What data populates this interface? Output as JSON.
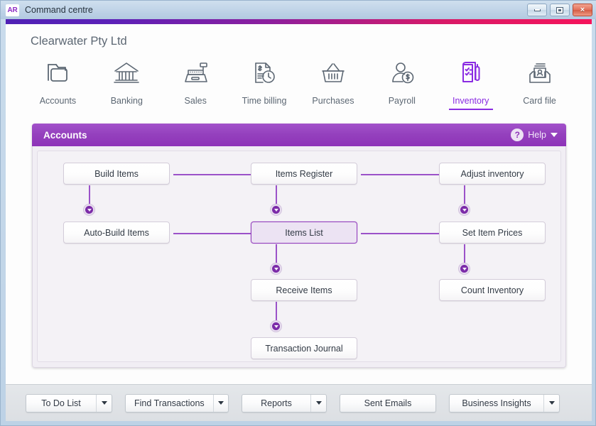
{
  "window": {
    "app_badge": "AR",
    "title": "Command centre",
    "buttons": {
      "minimize": "minimize-icon",
      "maximize": "maximize-icon",
      "close": "×"
    }
  },
  "company": {
    "name": "Clearwater Pty Ltd"
  },
  "nav": {
    "items": [
      {
        "label": "Accounts",
        "icon": "folders-icon",
        "active": false
      },
      {
        "label": "Banking",
        "icon": "bank-icon",
        "active": false
      },
      {
        "label": "Sales",
        "icon": "cash-register-icon",
        "active": false
      },
      {
        "label": "Time billing",
        "icon": "invoice-clock-icon",
        "active": false
      },
      {
        "label": "Purchases",
        "icon": "basket-icon",
        "active": false
      },
      {
        "label": "Payroll",
        "icon": "person-dollar-icon",
        "active": false
      },
      {
        "label": "Inventory",
        "icon": "clipboard-pen-icon",
        "active": true
      },
      {
        "label": "Card file",
        "icon": "card-tray-icon",
        "active": false
      }
    ]
  },
  "panel": {
    "title": "Accounts",
    "help_label": "Help",
    "help_icon": "question-mark-icon",
    "caret_icon": "chevron-down-icon"
  },
  "flow": {
    "boxes": [
      {
        "id": "build-items",
        "label": "Build Items",
        "selected": false
      },
      {
        "id": "items-register",
        "label": "Items Register",
        "selected": false
      },
      {
        "id": "adjust-inventory",
        "label": "Adjust inventory",
        "selected": false
      },
      {
        "id": "auto-build-items",
        "label": "Auto-Build Items",
        "selected": false
      },
      {
        "id": "items-list",
        "label": "Items List",
        "selected": true
      },
      {
        "id": "set-item-prices",
        "label": "Set Item Prices",
        "selected": false
      },
      {
        "id": "receive-items",
        "label": "Receive Items",
        "selected": false
      },
      {
        "id": "count-inventory",
        "label": "Count Inventory",
        "selected": false
      },
      {
        "id": "transaction-journal",
        "label": "Transaction Journal",
        "selected": false
      }
    ]
  },
  "toolbar": {
    "buttons": [
      {
        "label": "To Do List",
        "has_dropdown": true
      },
      {
        "label": "Find Transactions",
        "has_dropdown": true
      },
      {
        "label": "Reports",
        "has_dropdown": true
      },
      {
        "label": "Sent Emails",
        "has_dropdown": false
      },
      {
        "label": "Business Insights",
        "has_dropdown": true
      }
    ]
  },
  "colors": {
    "accent_purple": "#8a2be2",
    "panel_header": "#9440bd",
    "line_purple": "#9b52c9",
    "selected_fill": "#ece3f3",
    "text_grey": "#5c6773"
  }
}
